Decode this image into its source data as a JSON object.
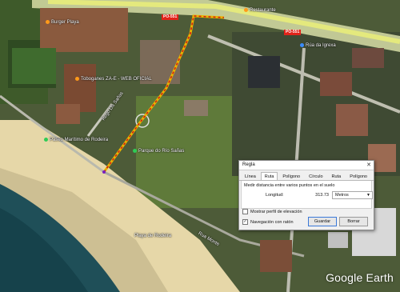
{
  "map": {
    "road_shields": [
      "PO-551",
      "PO-551"
    ],
    "places": [
      {
        "name": "Burger Playa",
        "pin": "orange"
      },
      {
        "name": "Toboganes ZA-E - WEB OFICIAL",
        "pin": "orange"
      },
      {
        "name": "Paseo Marítimo de Rodeira",
        "pin": "green"
      },
      {
        "name": "Parque do Río Sañas",
        "pin": "green"
      },
      {
        "name": "Rúa da Igrexa",
        "pin": "blue"
      },
      {
        "name": "Restaurante",
        "pin": "orange"
      },
      {
        "name": "Playa de Rodeira",
        "pin": "none"
      },
      {
        "name": "Rego Da Sañas",
        "pin": "none"
      },
      {
        "name": "Rua Monte",
        "pin": "none"
      }
    ],
    "watermark": "Google Earth",
    "path_color": "#e8b400",
    "path_dash_color": "#d01818"
  },
  "dialog": {
    "title": "Regla",
    "close": "✕",
    "tabs": [
      "Línea",
      "Ruta",
      "Polígono",
      "Círculo",
      "Ruta 3D",
      "Polígono 3D"
    ],
    "active_tab": "Ruta",
    "description": "Medir distancia entre varios puntos en el suelo",
    "length_label": "Longitud:",
    "length_value": "313.73",
    "unit": "Metros",
    "elevation_label": "Mostrar perfil de elevación",
    "navigation_label": "Navegación con ratón",
    "save_label": "Guardar",
    "clear_label": "Borrar"
  }
}
